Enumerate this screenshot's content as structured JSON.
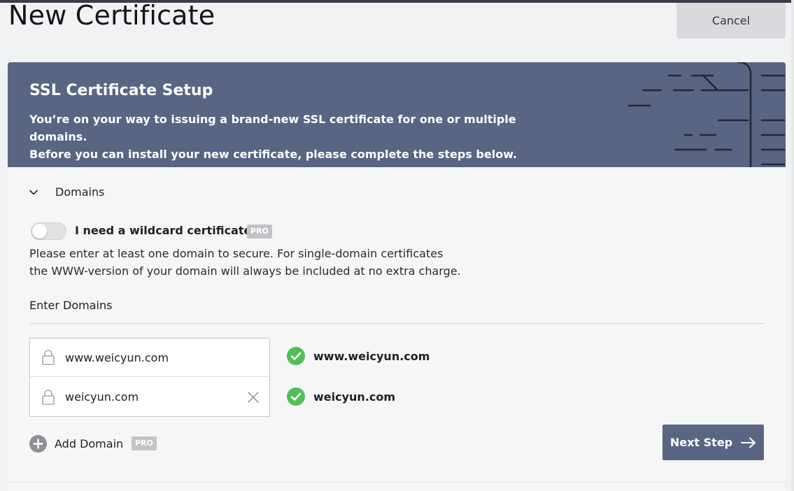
{
  "page": {
    "title": "New Certificate",
    "cancel_label": "Cancel"
  },
  "banner": {
    "title": "SSL Certificate Setup",
    "line1": "You’re on your way to issuing a brand-new SSL certificate for one or multiple domains.",
    "line2": "Before you can install your new certificate, please complete the steps below."
  },
  "domains_section": {
    "title": "Domains",
    "wildcard_label": "I need a wildcard certificate",
    "wildcard_enabled": false,
    "pro_badge": "PRO",
    "help_line1": "Please enter at least one domain to secure. For single-domain certificates",
    "help_line2": "the WWW-version of your domain will always be included at no extra charge.",
    "enter_label": "Enter Domains",
    "domains": [
      {
        "value": "www.weicyun.com",
        "status": "www.weicyun.com"
      },
      {
        "value": "weicyun.com",
        "status": "weicyun.com"
      }
    ],
    "add_domain_label": "Add Domain",
    "next_step_label": "Next Step"
  },
  "icons": {
    "chevron": "chevron-down-icon",
    "lock": "lock-icon",
    "remove": "close-icon",
    "check": "check-circle-icon",
    "plus": "plus-circle-icon",
    "arrow": "arrow-right-icon"
  },
  "colors": {
    "banner": "#5a6483",
    "primary_button": "#5a6483",
    "success": "#4fbf5a",
    "pro_badge": "#c3c4c8"
  }
}
